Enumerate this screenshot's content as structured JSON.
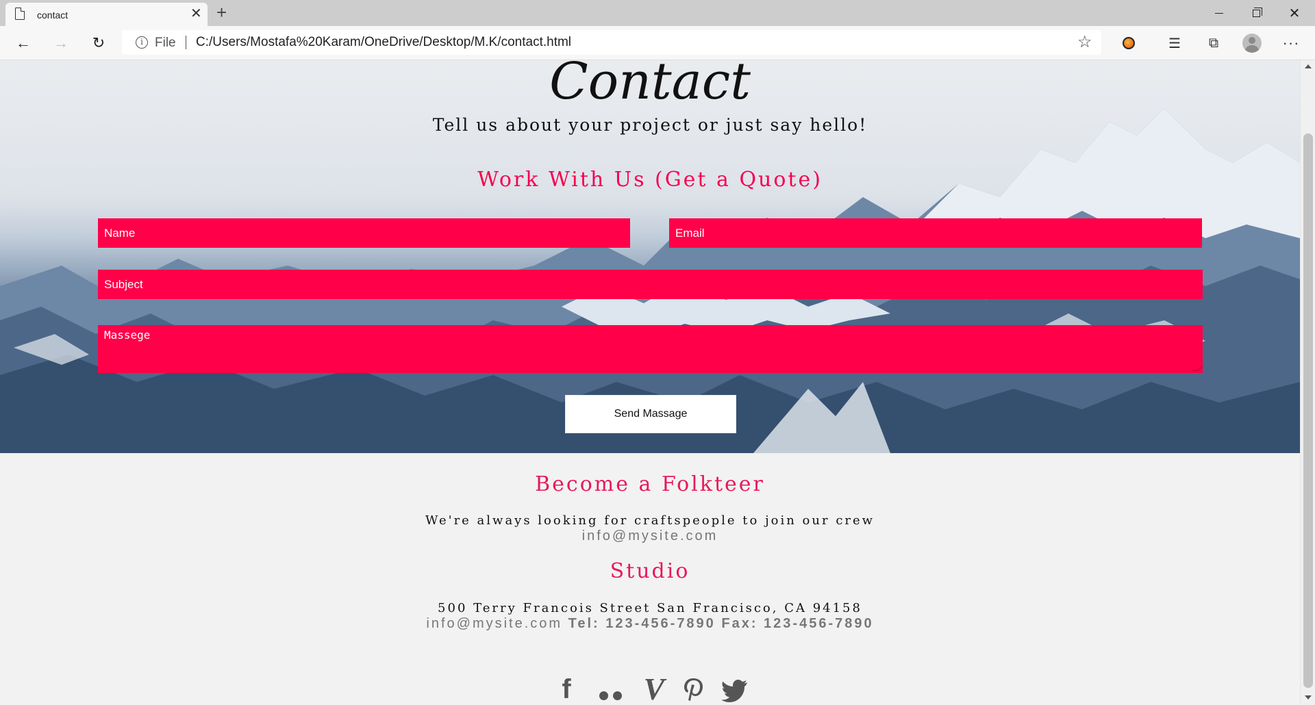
{
  "browser": {
    "tab_title": "contact",
    "new_tab_icon": "plus-icon",
    "address": {
      "scheme_label": "File",
      "url": "C:/Users/Mostafa%20Karam/OneDrive/Desktop/M.K/contact.html"
    }
  },
  "hero": {
    "title": "Contact",
    "subtitle": "Tell us about your project or just say hello!",
    "quote_title": "Work With Us (Get a Quote)"
  },
  "form": {
    "name_placeholder": "Name",
    "email_placeholder": "Email",
    "subject_placeholder": "Subject",
    "message_placeholder": "Massege",
    "send_label": "Send Massage"
  },
  "folkteer": {
    "title": "Become a Folkteer",
    "text": "We're always looking for craftspeople to join our crew",
    "email": "info@mysite.com"
  },
  "studio": {
    "title": "Studio",
    "address": "500 Terry Francois Street San Francisco, CA 94158",
    "email": "info@mysite.com",
    "tel": "Tel: 123-456-7890",
    "fax": "Fax: 123-456-7890"
  },
  "social": {
    "facebook": "f",
    "vimeo": "V",
    "pinterest": "℘",
    "twitter": "🐦"
  },
  "colors": {
    "accent": "#ff0049",
    "heading_pink": "#e8185a"
  }
}
